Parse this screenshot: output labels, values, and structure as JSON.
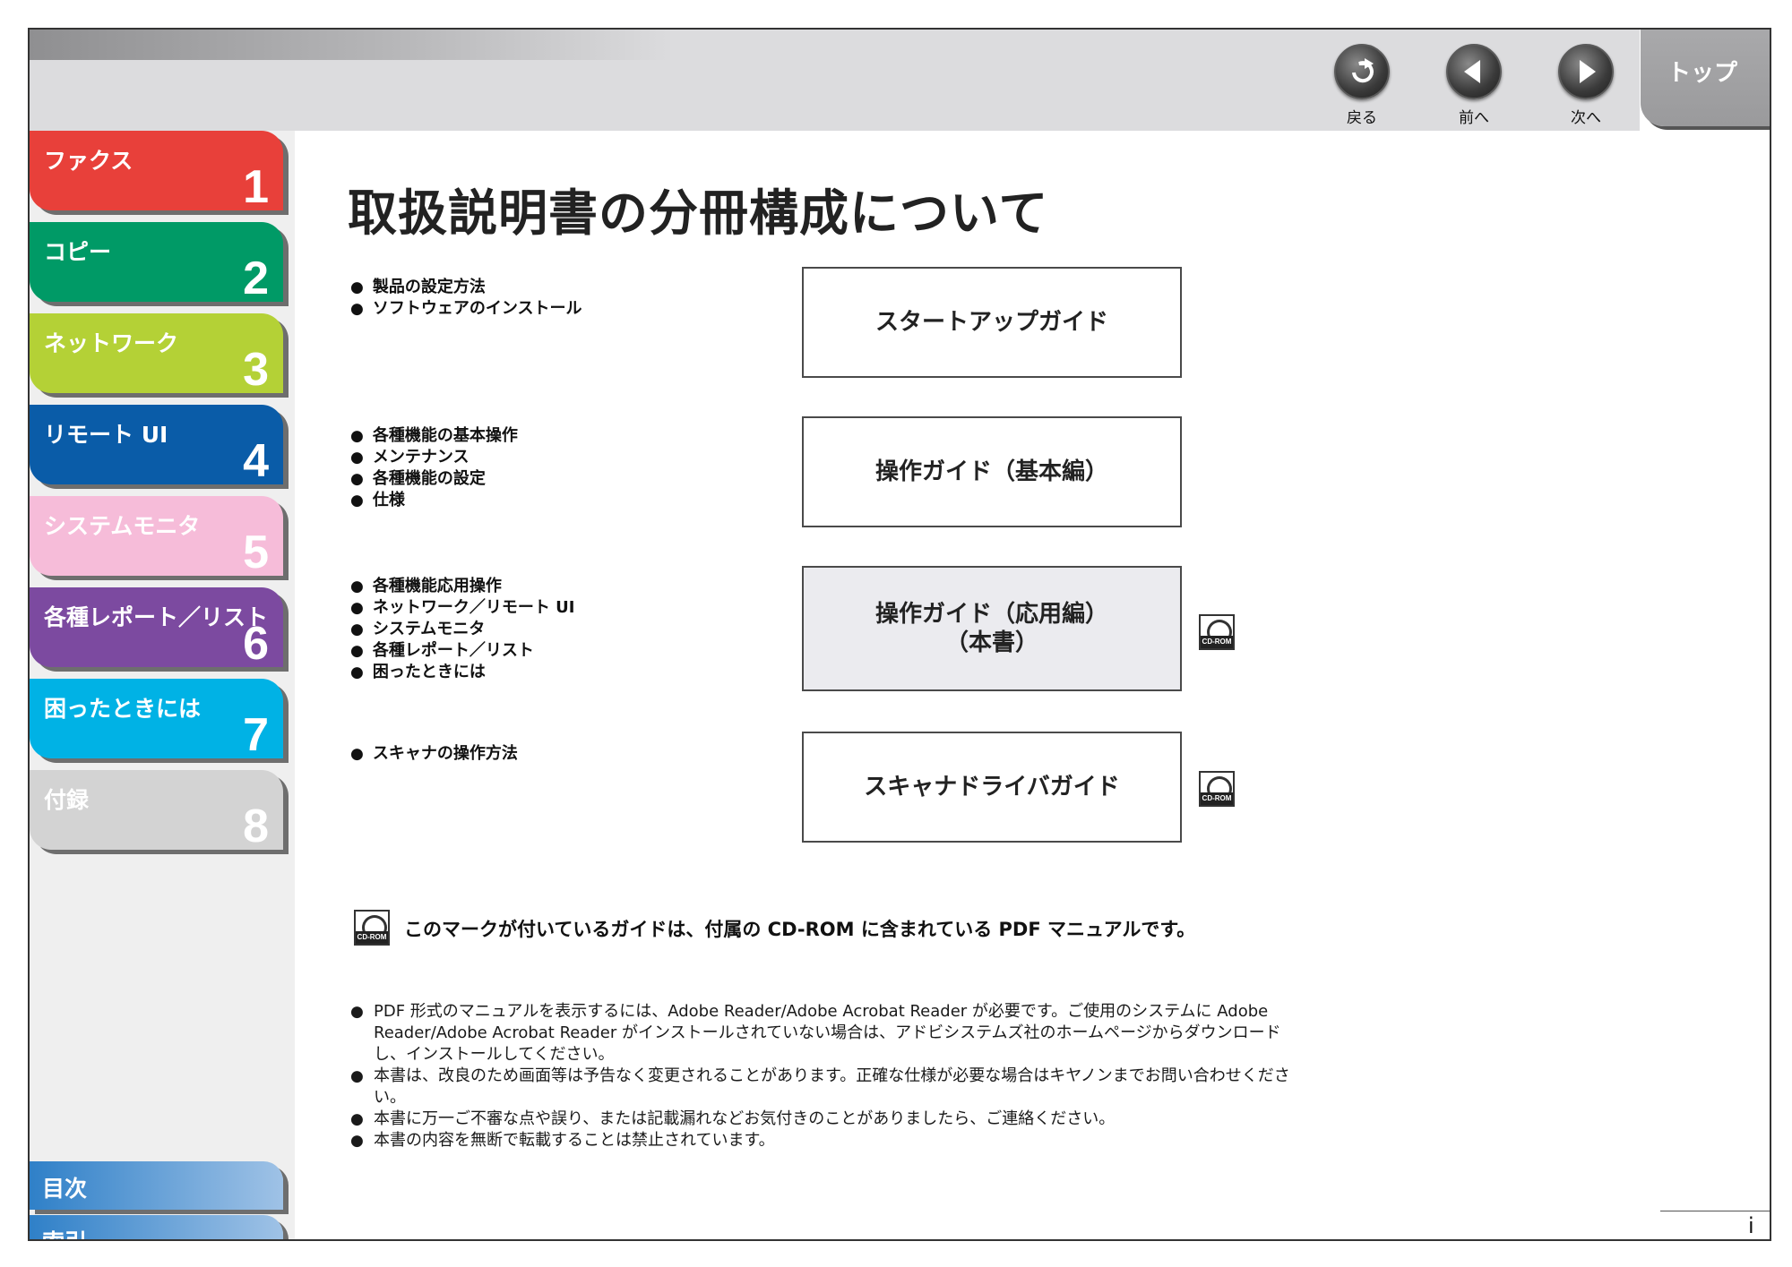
{
  "nav": {
    "back": "戻る",
    "prev": "前へ",
    "next": "次へ",
    "top": "トップ"
  },
  "sidebar": {
    "chapters": [
      {
        "label": "ファクス",
        "num": "1",
        "color": "#e8403a"
      },
      {
        "label": "コピー",
        "num": "2",
        "color": "#009a66"
      },
      {
        "label": "ネットワーク",
        "num": "3",
        "color": "#b4d136"
      },
      {
        "label": "リモート UI",
        "num": "4",
        "color": "#0a5ca8"
      },
      {
        "label": "システムモニタ",
        "num": "5",
        "color": "#f6bcd9"
      },
      {
        "label": "各種レポート／リスト",
        "num": "6",
        "color": "#7c4aa0"
      },
      {
        "label": "困ったときには",
        "num": "7",
        "color": "#00b2e5"
      },
      {
        "label": "付録",
        "num": "8",
        "color": "#d3d3d3"
      }
    ],
    "contents": "目次",
    "index": "索引"
  },
  "main": {
    "title": "取扱説明書の分冊構成について",
    "sections": [
      {
        "bullets": [
          "製品の設定方法",
          "ソフトウェアのインストール"
        ],
        "guide": [
          "スタートアップガイド"
        ]
      },
      {
        "bullets": [
          "各種機能の基本操作",
          "メンテナンス",
          "各種機能の設定",
          "仕様"
        ],
        "guide": [
          "操作ガイド（基本編）"
        ]
      },
      {
        "bullets": [
          "各種機能応用操作",
          "ネットワーク／リモート UI",
          "システムモニタ",
          "各種レポート／リスト",
          "困ったときには"
        ],
        "guide": [
          "操作ガイド（応用編）",
          "（本書）"
        ]
      },
      {
        "bullets": [
          "スキャナの操作方法"
        ],
        "guide": [
          "スキャナドライバガイド"
        ]
      }
    ],
    "cd_label": "CD-ROM",
    "note": "このマークが付いているガイドは、付属の CD-ROM に含まれている PDF マニュアルです。",
    "notes": [
      "PDF 形式のマニュアルを表示するには、Adobe Reader/Adobe Acrobat Reader が必要です。ご使用のシステムに Adobe Reader/Adobe Acrobat Reader がインストールされていない場合は、アドビシステムズ社のホームページからダウンロードし、インストールしてください。",
      "本書は、改良のため画面等は予告なく変更されることがあります。正確な仕様が必要な場合はキヤノンまでお問い合わせください。",
      "本書に万一ご不審な点や誤り、または記載漏れなどお気付きのことがありましたら、ご連絡ください。",
      "本書の内容を無断で転載することは禁止されています。"
    ],
    "page_number": "i"
  }
}
